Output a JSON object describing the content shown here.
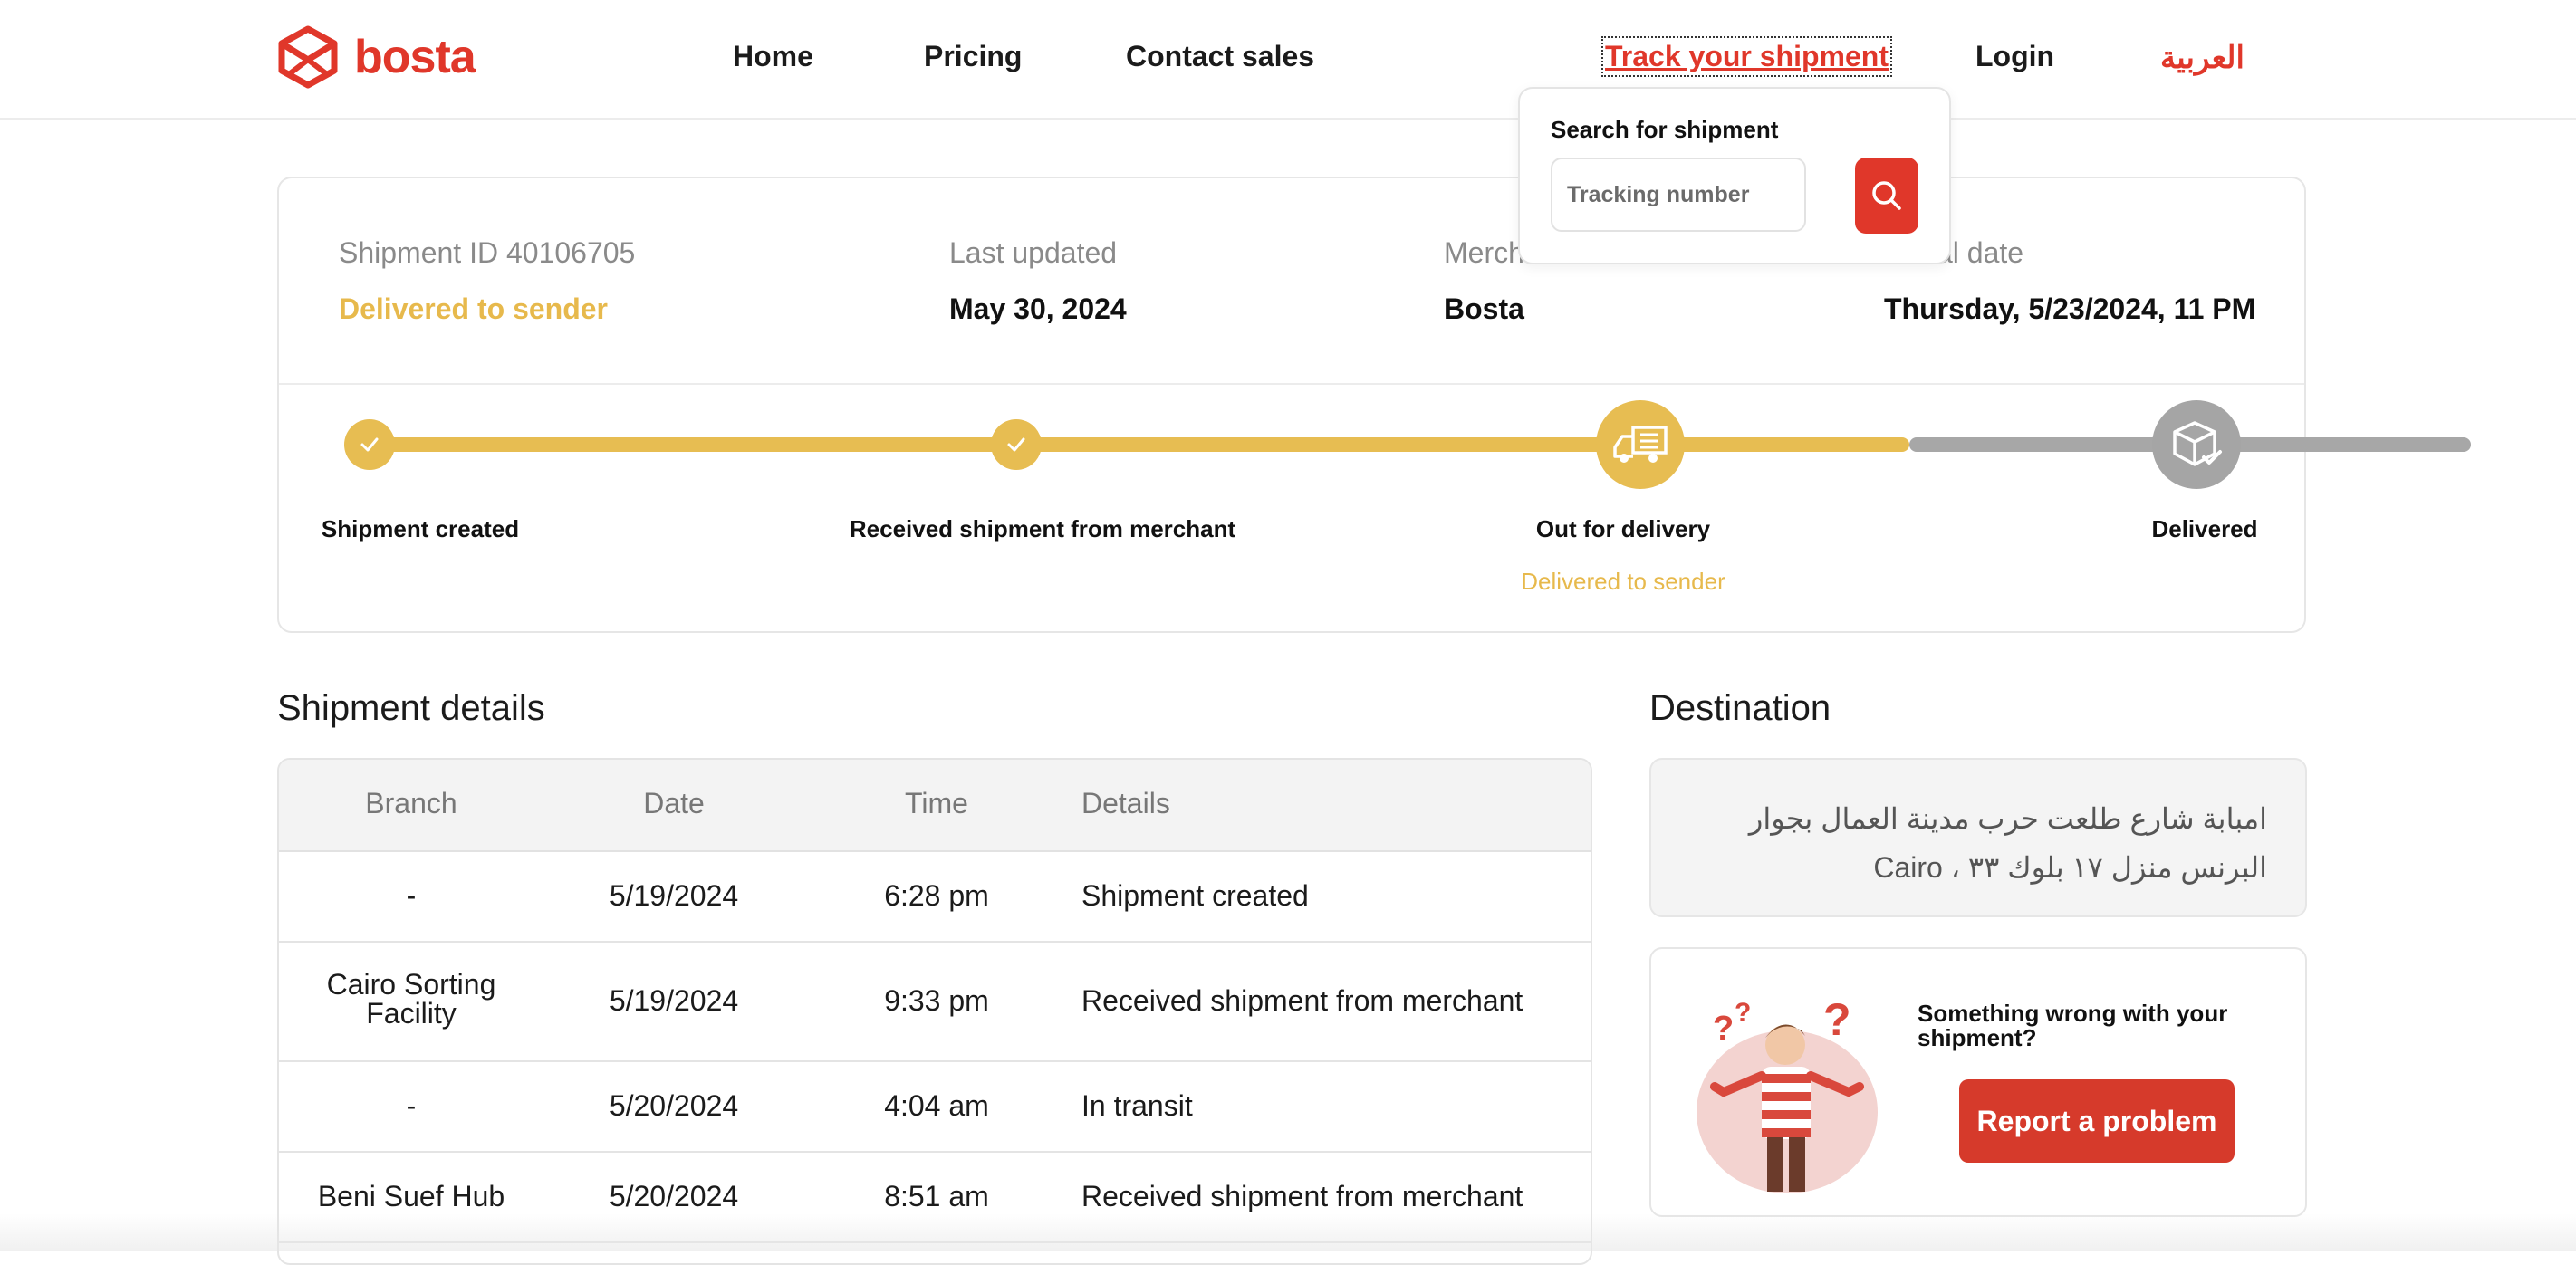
{
  "header": {
    "logo_text": "bosta",
    "nav": {
      "home": "Home",
      "pricing": "Pricing",
      "contact_sales": "Contact sales",
      "track_shipment": "Track your shipment",
      "login": "Login",
      "language": "العربية"
    }
  },
  "search_popover": {
    "title": "Search for shipment",
    "placeholder": "Tracking number",
    "button_icon": "search-icon"
  },
  "summary": {
    "shipment_id_label": "Shipment ID 40106705",
    "status": "Delivered to sender",
    "last_updated_label": "Last updated",
    "last_updated_value": "May 30, 2024",
    "merchant_label": "Merch",
    "merchant_value": "Bosta",
    "date_label": "al date",
    "date_value": "Thursday, 5/23/2024, 11 PM"
  },
  "progress": {
    "steps": [
      {
        "label": "Shipment created",
        "state": "done",
        "icon": "check-icon"
      },
      {
        "label": "Received shipment from merchant",
        "state": "done",
        "icon": "check-icon"
      },
      {
        "label": "Out for delivery",
        "state": "active",
        "icon": "truck-icon",
        "sub": "Delivered to sender"
      },
      {
        "label": "Delivered",
        "state": "pending",
        "icon": "box-check-icon"
      }
    ]
  },
  "details": {
    "title": "Shipment details",
    "columns": [
      "Branch",
      "Date",
      "Time",
      "Details"
    ],
    "rows": [
      {
        "branch": "-",
        "date": "5/19/2024",
        "time": "6:28 pm",
        "details": "Shipment created"
      },
      {
        "branch": "Cairo Sorting Facility",
        "date": "5/19/2024",
        "time": "9:33 pm",
        "details": "Received shipment from merchant"
      },
      {
        "branch": "-",
        "date": "5/20/2024",
        "time": "4:04 am",
        "details": "In transit"
      },
      {
        "branch": "Beni Suef Hub",
        "date": "5/20/2024",
        "time": "8:51 am",
        "details": "Received shipment from merchant"
      }
    ]
  },
  "destination": {
    "title": "Destination",
    "address": "امبابة شارع طلعت حرب مدينة العمال بجوار البرنس منزل ١٧ بلوك ٣٣ ، Cairo"
  },
  "help": {
    "title": "Something wrong with your shipment?",
    "button": "Report a problem"
  },
  "colors": {
    "brand_red": "#e0372a",
    "progress_yellow": "#e7bd52",
    "pending_gray": "#a7a7a7"
  }
}
